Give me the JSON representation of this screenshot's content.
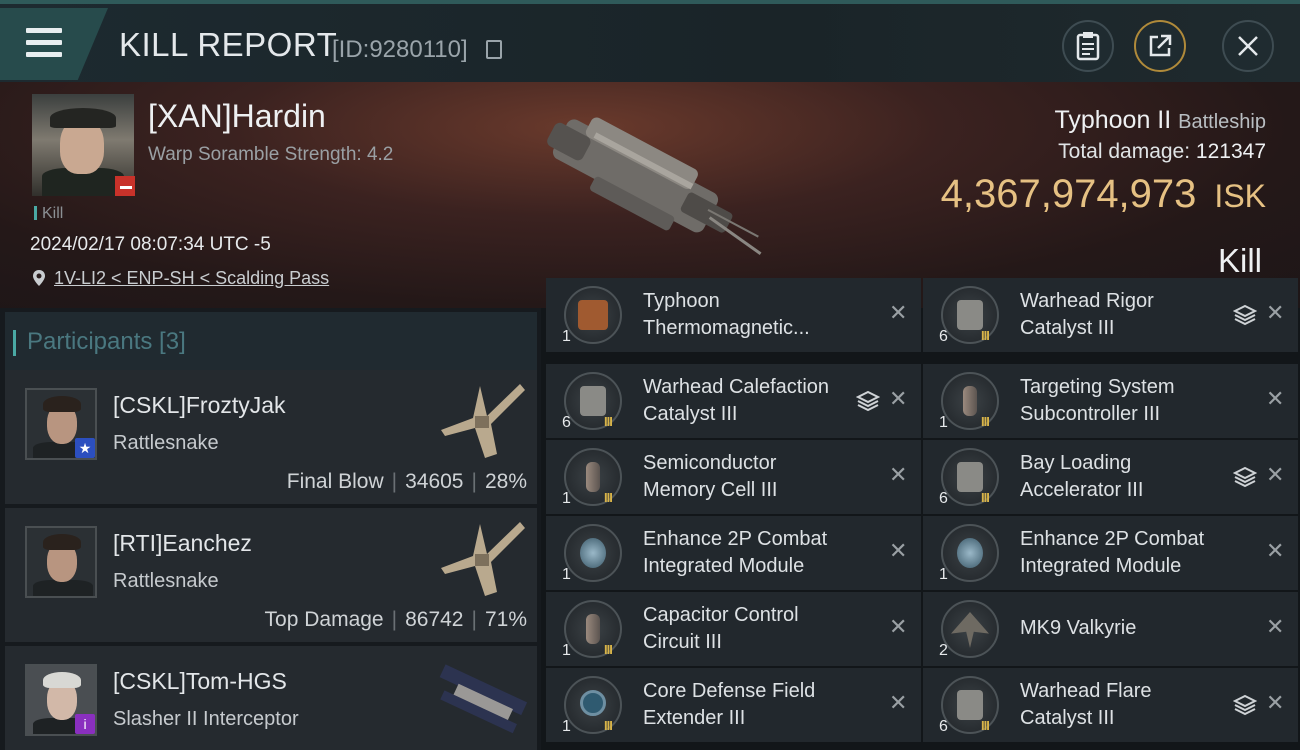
{
  "header": {
    "title": "KILL REPORT",
    "report_id": "[ID:9280110]"
  },
  "victim": {
    "name": "[XAN]Hardin",
    "scramble": "Warp Soramble Strength: 4.2",
    "kill_tag": "Kill",
    "datetime": "2024/02/17 08:07:34 UTC -5",
    "location": "1V-LI2 < ENP-SH < Scalding Pass",
    "ship_name": "Typhoon II",
    "ship_class": "Battleship",
    "total_damage_label": "Total damage:",
    "total_damage": "121347",
    "isk_value": "4,367,974,973",
    "isk_unit": "ISK",
    "result": "Kill"
  },
  "participants": {
    "header": "Participants [3]",
    "rows": [
      {
        "name": "[CSKL]FroztyJak",
        "ship": "Rattlesnake",
        "role": "Final Blow",
        "damage": "34605",
        "percent": "28%",
        "badge": "★",
        "badge_color": "#2c4fbf"
      },
      {
        "name": "[RTI]Eanchez",
        "ship": "Rattlesnake",
        "role": "Top Damage",
        "damage": "86742",
        "percent": "71%",
        "badge": "",
        "badge_color": ""
      },
      {
        "name": "[CSKL]Tom-HGS",
        "ship": "Slasher II Interceptor",
        "role": "",
        "damage": "",
        "percent": "",
        "badge": "i",
        "badge_color": "#8a2fbf"
      }
    ]
  },
  "modules": [
    {
      "name_line1": "Typhoon",
      "name_line2": "Thermomagnetic...",
      "qty": "1",
      "tier": "",
      "icon": "orange",
      "stack": false
    },
    {
      "name_line1": "Warhead Rigor",
      "name_line2": "Catalyst III",
      "qty": "6",
      "tier": "III",
      "icon": "box",
      "stack": true
    },
    {
      "name_line1": "Warhead Calefaction",
      "name_line2": "Catalyst III",
      "qty": "6",
      "tier": "III",
      "icon": "box",
      "stack": true
    },
    {
      "name_line1": "Targeting System",
      "name_line2": "Subcontroller III",
      "qty": "1",
      "tier": "III",
      "icon": "cyl",
      "stack": false
    },
    {
      "name_line1": "Semiconductor",
      "name_line2": "Memory Cell III",
      "qty": "1",
      "tier": "III",
      "icon": "cyl",
      "stack": false
    },
    {
      "name_line1": "Bay Loading",
      "name_line2": "Accelerator III",
      "qty": "6",
      "tier": "III",
      "icon": "box",
      "stack": true
    },
    {
      "name_line1": "Enhance 2P Combat",
      "name_line2": "Integrated Module",
      "qty": "1",
      "tier": "",
      "icon": "blue",
      "stack": false
    },
    {
      "name_line1": "Enhance 2P Combat",
      "name_line2": "Integrated Module",
      "qty": "1",
      "tier": "",
      "icon": "blue",
      "stack": false
    },
    {
      "name_line1": "Capacitor Control",
      "name_line2": "Circuit III",
      "qty": "1",
      "tier": "III",
      "icon": "cyl",
      "stack": false
    },
    {
      "name_line1": "MK9  Valkyrie",
      "name_line2": "",
      "qty": "2",
      "tier": "",
      "icon": "drone",
      "stack": false
    },
    {
      "name_line1": "Core Defense Field",
      "name_line2": "Extender III",
      "qty": "1",
      "tier": "III",
      "icon": "ring",
      "stack": false
    },
    {
      "name_line1": "Warhead Flare",
      "name_line2": "Catalyst III",
      "qty": "6",
      "tier": "III",
      "icon": "box",
      "stack": true
    }
  ],
  "icons": {
    "menu": "hamburger-icon",
    "copy": "copy-icon",
    "clipboard": "clipboard-icon",
    "share": "share-icon",
    "close": "close-icon",
    "pin": "location-pin-icon",
    "stack": "stack-icon",
    "remove": "close-x-icon"
  },
  "colors": {
    "isk": "#e6c183",
    "accent": "#4aa9a4",
    "tier": "#d8b449"
  }
}
